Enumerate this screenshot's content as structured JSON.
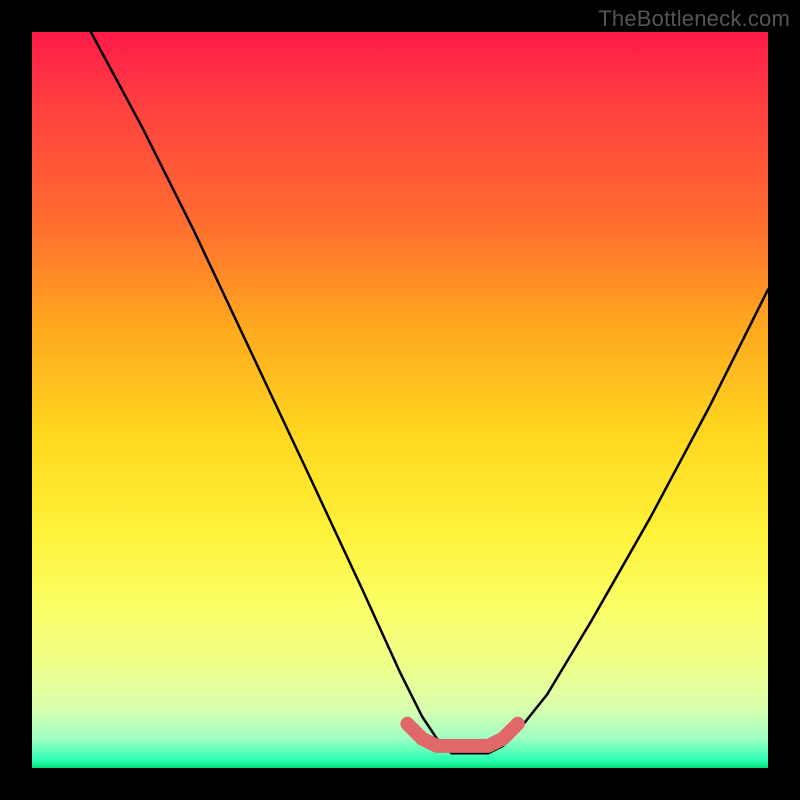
{
  "watermark": "TheBottleneck.com",
  "chart_data": {
    "type": "line",
    "title": "",
    "xlabel": "",
    "ylabel": "",
    "xlim": [
      0,
      100
    ],
    "ylim": [
      0,
      100
    ],
    "grid": false,
    "legend": false,
    "annotations": [],
    "series": [
      {
        "name": "curve",
        "color": "#000000",
        "x": [
          8,
          15,
          22,
          30,
          38,
          45,
          50,
          53,
          55,
          57,
          59,
          60,
          62,
          64,
          66,
          70,
          76,
          84,
          92,
          100
        ],
        "values": [
          100,
          87,
          73,
          56,
          39,
          24,
          13,
          7,
          4,
          2,
          2,
          2,
          2,
          3,
          5,
          10,
          20,
          34,
          49,
          65
        ]
      },
      {
        "name": "trough-highlight",
        "color": "#e06868",
        "x": [
          51,
          53,
          55,
          57,
          59,
          60,
          62,
          64,
          66
        ],
        "values": [
          6,
          4,
          3,
          3,
          3,
          3,
          3,
          4,
          6
        ]
      }
    ]
  }
}
